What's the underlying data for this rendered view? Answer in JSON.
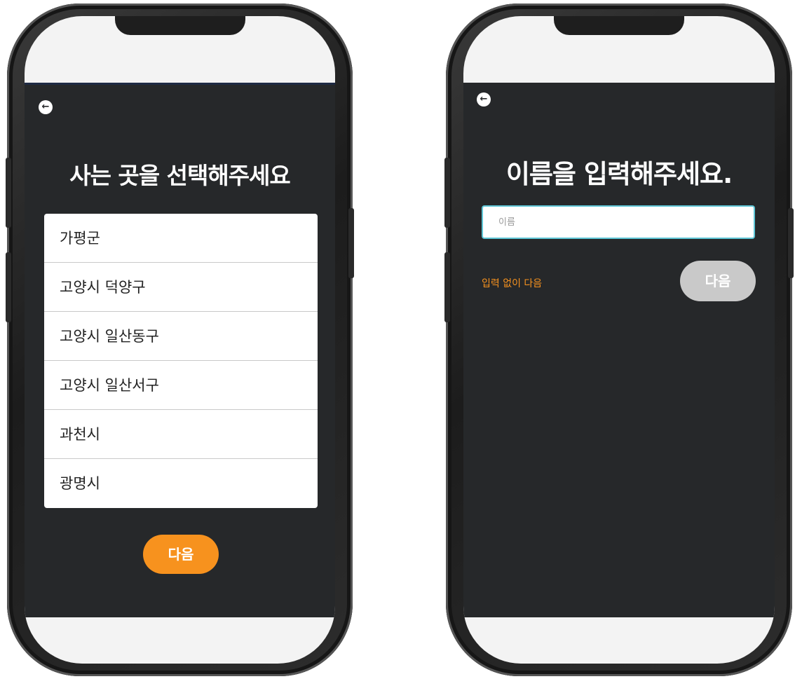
{
  "region_screen": {
    "back_icon": "←",
    "title": "사는 곳을 선택해주세요",
    "regions": [
      "가평군",
      "고양시 덕양구",
      "고양시 일산동구",
      "고양시 일산서구",
      "과천시",
      "광명시"
    ],
    "next_label": "다음",
    "accent_color": "#f7921e"
  },
  "name_screen": {
    "back_icon": "←",
    "title": "이름을 입력해주세요.",
    "name_placeholder": "이름",
    "name_value": "",
    "skip_label": "입력 없이 다음",
    "next_label": "다음",
    "next_disabled": true
  }
}
